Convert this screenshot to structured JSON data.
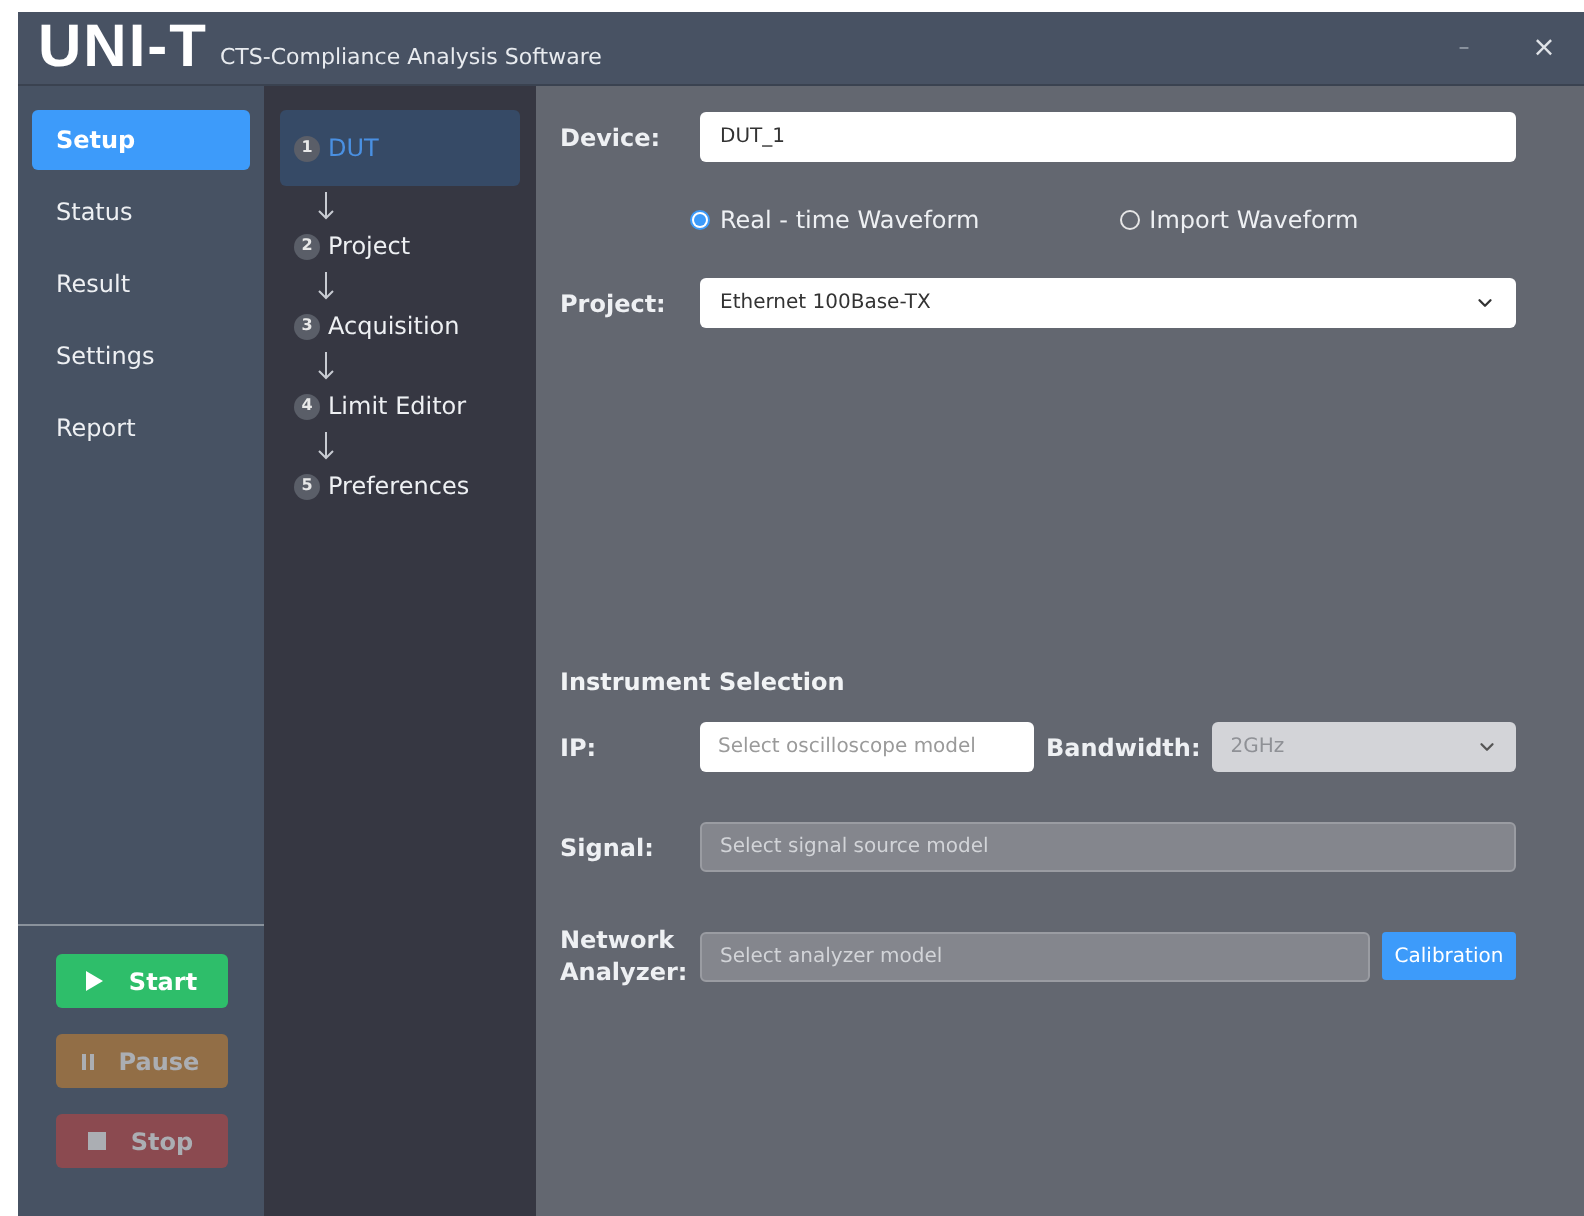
{
  "window": {
    "logo": "UNI-T",
    "title": "CTS-Compliance Analysis Software",
    "controls": [
      {
        "kind": "minimize",
        "label": "–"
      },
      {
        "kind": "close",
        "label": "×"
      }
    ]
  },
  "nav": [
    {
      "label": "Setup",
      "selected": true
    },
    {
      "label": "Status",
      "selected": false
    },
    {
      "label": "Result",
      "selected": false
    },
    {
      "label": "Settings",
      "selected": false
    },
    {
      "label": "Report",
      "selected": false
    }
  ],
  "actions": [
    {
      "kind": "start",
      "label": "Start",
      "disabled": false
    },
    {
      "kind": "pause",
      "label": "Pause",
      "disabled": true
    },
    {
      "kind": "stop",
      "label": "Stop",
      "disabled": true
    }
  ],
  "steps": [
    {
      "number": "1",
      "label": "DUT",
      "selected": true
    },
    {
      "number": "2",
      "label": "Project",
      "selected": false
    },
    {
      "number": "3",
      "label": "Acquisition",
      "selected": false
    },
    {
      "number": "4",
      "label": "Limit Editor",
      "selected": false
    },
    {
      "number": "5",
      "label": "Preferences",
      "selected": false
    }
  ],
  "device": {
    "label": "Device:",
    "value": "DUT_1"
  },
  "waveform": [
    {
      "label": "Real - time Waveform",
      "selected": true
    },
    {
      "label": "Import Waveform",
      "selected": false
    }
  ],
  "project": {
    "label": "Project:",
    "value": "Ethernet 100Base-TX"
  },
  "instrument": {
    "title": "Instrument Selection",
    "ip": {
      "label": "IP:",
      "placeholder": "Select oscilloscope model"
    },
    "bandwidth": {
      "label": "Bandwidth:",
      "value": "2GHz",
      "disabled": true
    },
    "signal": {
      "label": "Signal:",
      "placeholder": "Select signal source model",
      "disabled": true
    },
    "analyzer": {
      "label": "Network Analyzer:",
      "placeholder": "Select analyzer model",
      "disabled": true
    },
    "calibration": "Calibration"
  }
}
